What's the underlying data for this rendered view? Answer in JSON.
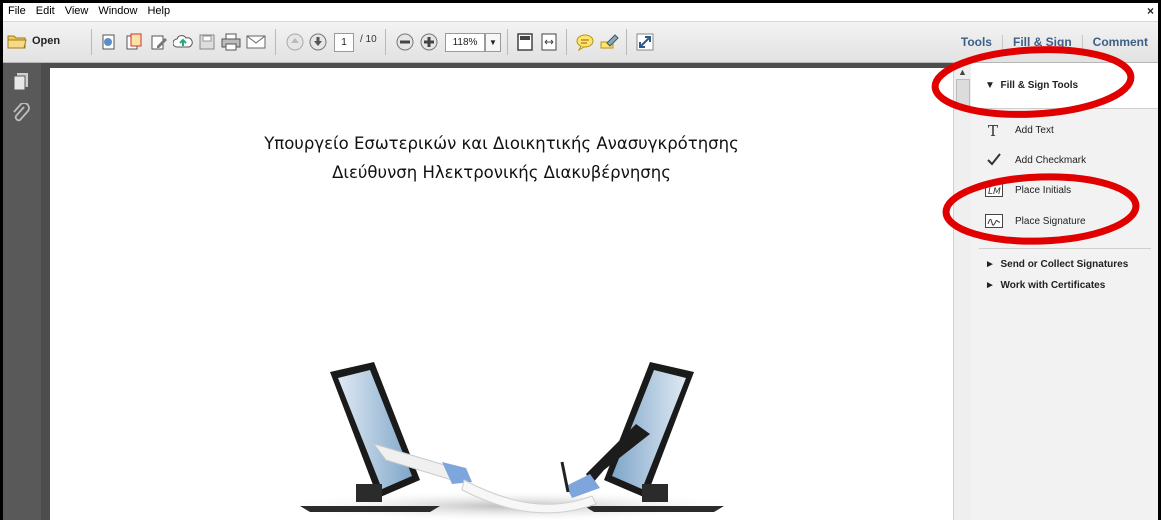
{
  "menu": {
    "items": [
      "File",
      "Edit",
      "View",
      "Window",
      "Help"
    ],
    "close": "×"
  },
  "toolbar": {
    "open_label": "Open",
    "page_current": "1",
    "page_total": "/ 10",
    "zoom": "118%",
    "right_tabs": [
      "Tools",
      "Fill & Sign",
      "Comment"
    ]
  },
  "document": {
    "line1": "Υπουργείο Εσωτερικών και Διοικητικής Ανασυγκρότησης",
    "line2": "Διεύθυνση Ηλεκτρονικής Διακυβέρνησης"
  },
  "panel": {
    "section_title": "Fill & Sign Tools",
    "tools": [
      {
        "label": "Add Text",
        "icon": "text-T-icon"
      },
      {
        "label": "Add Checkmark",
        "icon": "checkmark-icon"
      },
      {
        "label": "Place Initials",
        "icon": "initials-icon"
      },
      {
        "label": "Place Signature",
        "icon": "signature-icon"
      }
    ],
    "collapsed_sections": [
      "Send or Collect Signatures",
      "Work with Certificates"
    ]
  },
  "colors": {
    "annotation": "#e00000",
    "tab_text": "#3b5f86",
    "nav_bg": "#595959"
  }
}
